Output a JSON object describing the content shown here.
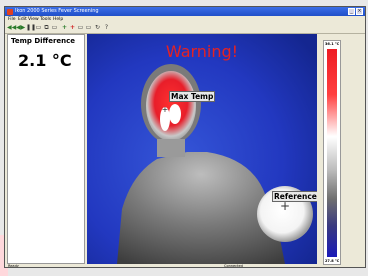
{
  "window": {
    "title": "Ikon 2000 Series Fever Screening"
  },
  "menu": [
    "File",
    "Edit",
    "View",
    "Tools",
    "Help"
  ],
  "toolbar": [
    "◀◀",
    "◀▶",
    "❚❚",
    "▭",
    "⧉",
    "▭",
    "+",
    "+",
    "▭",
    "▭",
    "↻",
    "?"
  ],
  "left_panel": {
    "label": "Temp Difference",
    "value": "2.1 °C"
  },
  "thermal": {
    "warning": "Warning!",
    "markers": {
      "max": "Max Temp",
      "ref": "Reference"
    }
  },
  "scale": {
    "max": "36.1 °C",
    "min": "27.8 °C"
  },
  "status": {
    "left": "Ready",
    "middle": "Connected"
  },
  "colors": {
    "warning": "#e52222",
    "cold": "#1c2fb0",
    "hot": "#ee1c23",
    "titlebar": "#1f4fc8"
  }
}
